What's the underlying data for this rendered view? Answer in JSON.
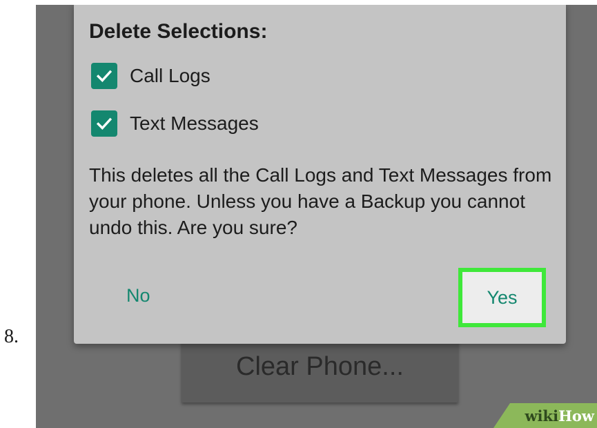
{
  "step": {
    "number": "8."
  },
  "background": {
    "button_label": "Clear Phone..."
  },
  "dialog": {
    "title": "Delete Selections:",
    "options": [
      {
        "label": "Call Logs",
        "checked": true,
        "icon": "checkmark-icon"
      },
      {
        "label": "Text Messages",
        "checked": true,
        "icon": "checkmark-icon"
      }
    ],
    "message": "This deletes all the Call Logs and Text Messages from your phone. Unless you have a Backup you cannot undo this. Are you sure?",
    "no_label": "No",
    "yes_label": "Yes"
  },
  "watermark": {
    "part1": "wiki",
    "part2": "How"
  },
  "colors": {
    "accent": "#14876f",
    "highlight": "#3fe83a",
    "dialog_bg": "#c4c4c4",
    "screen_bg": "#6f6f6f",
    "watermark_bg": "#8cb85a"
  }
}
